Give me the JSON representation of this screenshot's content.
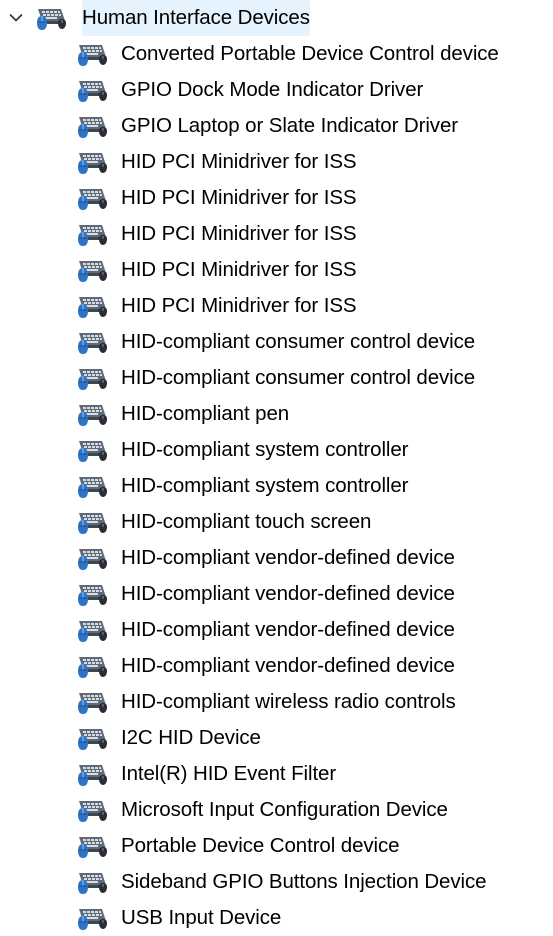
{
  "category": {
    "label": "Human Interface Devices",
    "expanded": true,
    "expander_icon": "chevron-down-icon",
    "icon": "hid-device-icon"
  },
  "device_icon": "hid-device-icon",
  "colors": {
    "icon_keyboard_body": "#5f6a78",
    "icon_keys": "#d7dde4",
    "icon_mouse": "#2f74c9",
    "selection_hover": "#e5f3ff"
  },
  "devices": [
    {
      "label": "Converted Portable Device Control device"
    },
    {
      "label": "GPIO Dock Mode Indicator Driver"
    },
    {
      "label": "GPIO Laptop or Slate Indicator Driver"
    },
    {
      "label": "HID PCI Minidriver for ISS"
    },
    {
      "label": "HID PCI Minidriver for ISS"
    },
    {
      "label": "HID PCI Minidriver for ISS"
    },
    {
      "label": "HID PCI Minidriver for ISS"
    },
    {
      "label": "HID PCI Minidriver for ISS"
    },
    {
      "label": "HID-compliant consumer control device"
    },
    {
      "label": "HID-compliant consumer control device"
    },
    {
      "label": "HID-compliant pen"
    },
    {
      "label": "HID-compliant system controller"
    },
    {
      "label": "HID-compliant system controller"
    },
    {
      "label": "HID-compliant touch screen"
    },
    {
      "label": "HID-compliant vendor-defined device"
    },
    {
      "label": "HID-compliant vendor-defined device"
    },
    {
      "label": "HID-compliant vendor-defined device"
    },
    {
      "label": "HID-compliant vendor-defined device"
    },
    {
      "label": "HID-compliant wireless radio controls"
    },
    {
      "label": "I2C HID Device"
    },
    {
      "label": "Intel(R) HID Event Filter"
    },
    {
      "label": "Microsoft Input Configuration Device"
    },
    {
      "label": "Portable Device Control device"
    },
    {
      "label": "Sideband GPIO Buttons Injection Device"
    },
    {
      "label": "USB Input Device"
    }
  ]
}
